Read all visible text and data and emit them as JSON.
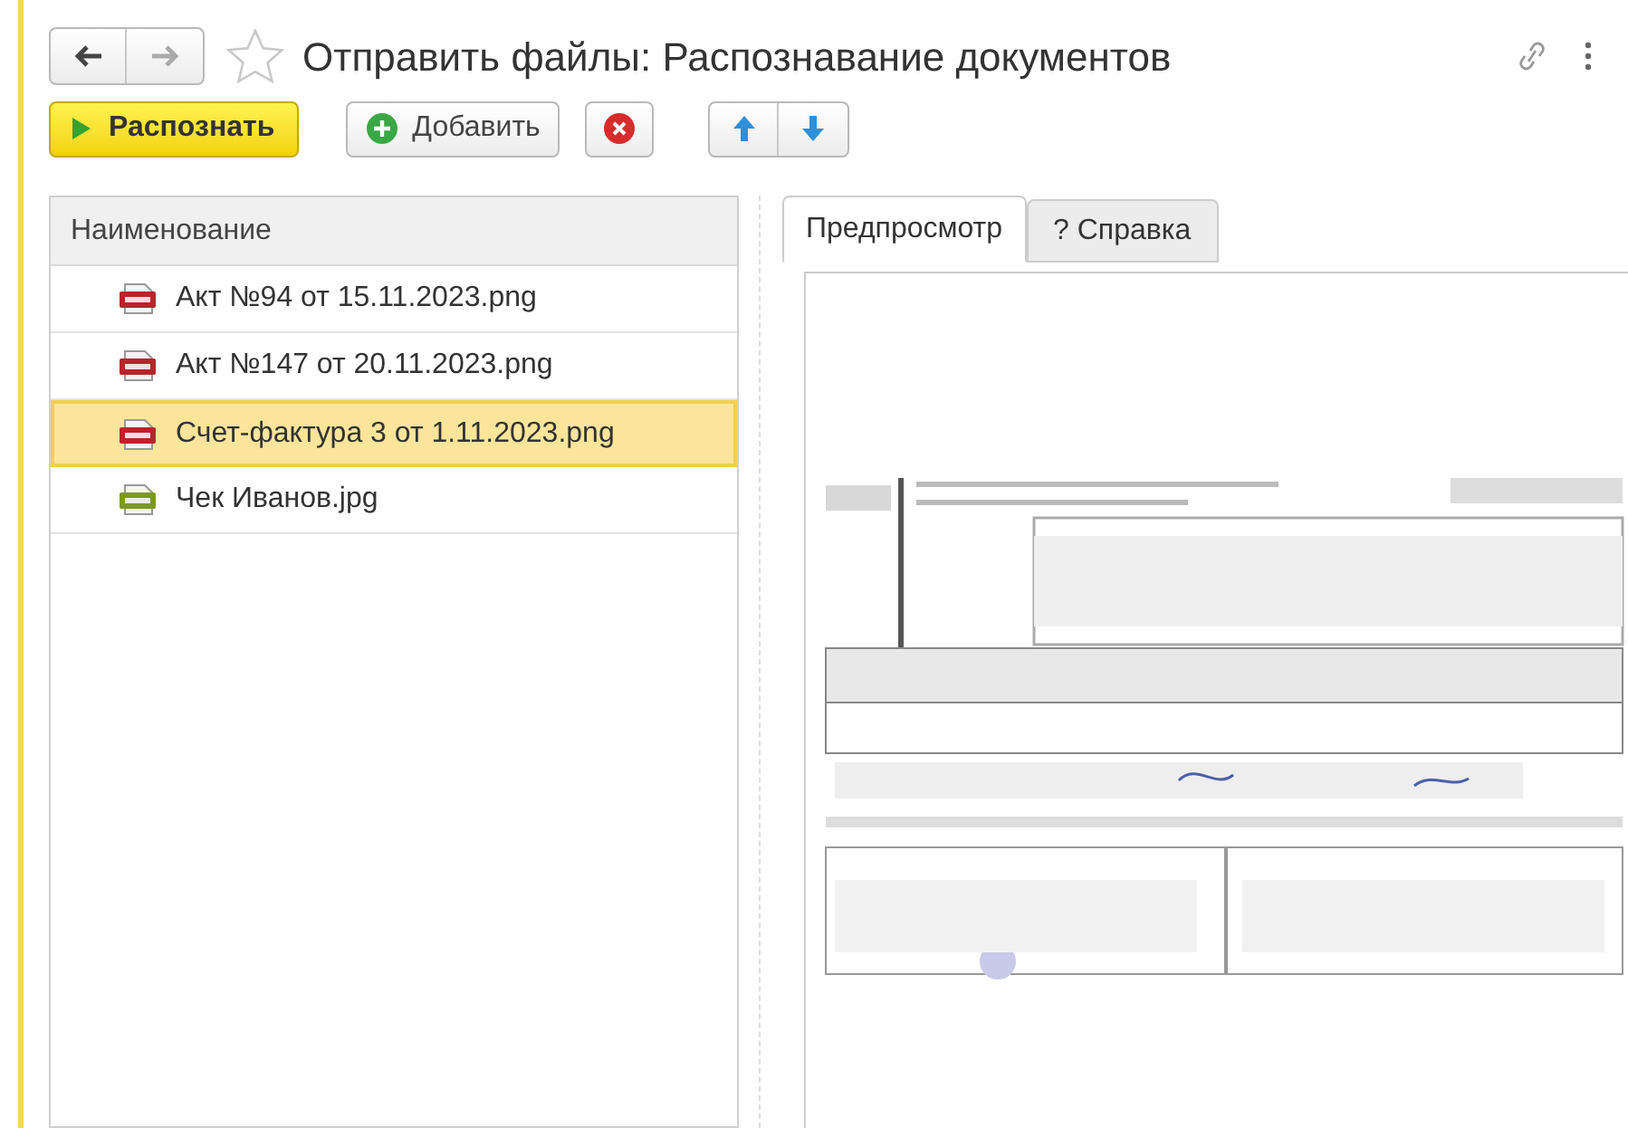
{
  "window": {
    "title": "Отправить файлы: Распознавание документов"
  },
  "toolbar": {
    "recognize": "Распознать",
    "add": "Добавить"
  },
  "file_list": {
    "column": "Наименование",
    "rows": [
      {
        "name": "Акт №94 от 15.11.2023.png",
        "kind": "png",
        "selected": false
      },
      {
        "name": "Акт №147 от 20.11.2023.png",
        "kind": "png",
        "selected": false
      },
      {
        "name": "Счет-фактура 3 от 1.11.2023.png",
        "kind": "png",
        "selected": true
      },
      {
        "name": "Чек Иванов.jpg",
        "kind": "jpg",
        "selected": false
      }
    ]
  },
  "tabs": [
    {
      "label": "Предпросмотр",
      "selected": true
    },
    {
      "label": "? Справка",
      "selected": false
    }
  ]
}
